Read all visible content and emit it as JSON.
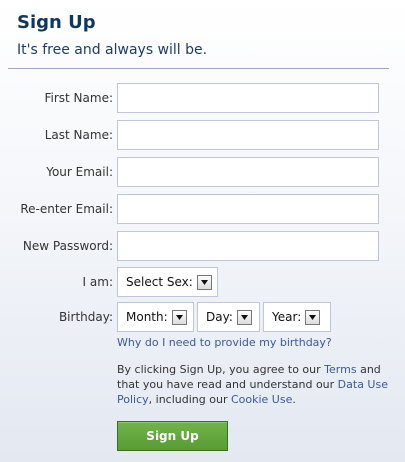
{
  "header": {
    "title": "Sign Up",
    "tagline": "It's free and always will be."
  },
  "form": {
    "first_name": {
      "label": "First Name:",
      "value": ""
    },
    "last_name": {
      "label": "Last Name:",
      "value": ""
    },
    "email": {
      "label": "Your Email:",
      "value": ""
    },
    "reenter_email": {
      "label": "Re-enter Email:",
      "value": ""
    },
    "password": {
      "label": "New Password:",
      "value": ""
    },
    "sex": {
      "label": "I am:",
      "selected": "Select Sex:"
    },
    "birthday": {
      "label": "Birthday:",
      "month": "Month:",
      "day": "Day:",
      "year": "Year:"
    },
    "why_birthday_link": "Why do I need to provide my birthday?"
  },
  "terms": {
    "part1": "By clicking Sign Up, you agree to our ",
    "terms_link": "Terms",
    "part2": " and that you have read and understand our ",
    "data_policy_link": "Data Use Policy",
    "part3": ", including our ",
    "cookie_link": "Cookie Use",
    "part4": "."
  },
  "signup_button": "Sign Up"
}
